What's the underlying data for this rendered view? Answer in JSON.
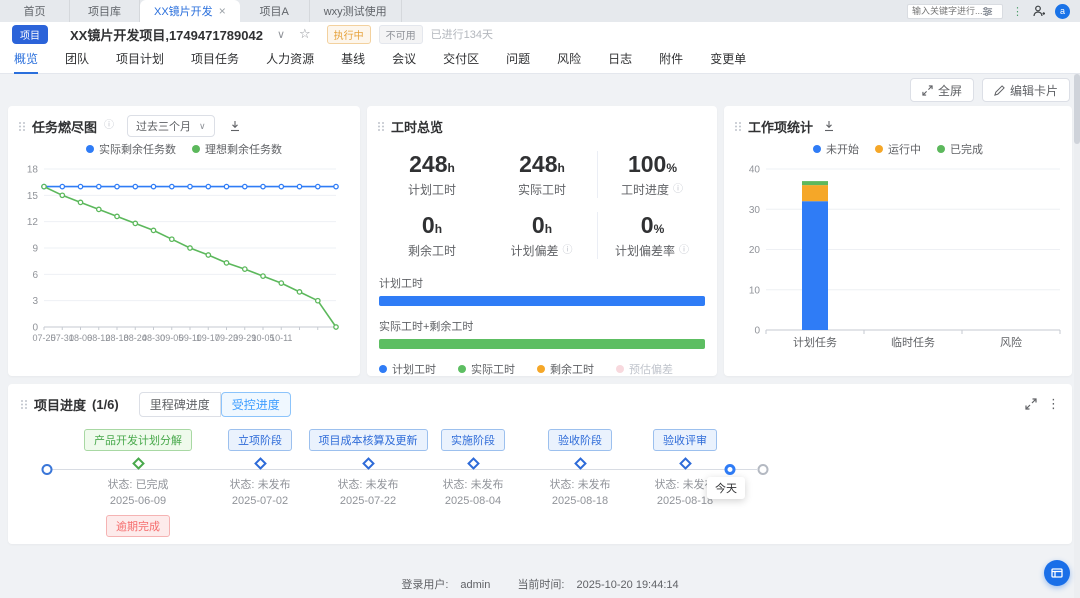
{
  "icons": {
    "info": "ⓘ",
    "chevron_down": "∨",
    "star": "☆",
    "close": "×",
    "more": "⋮"
  },
  "top_bar": {
    "tabs": [
      {
        "label": "首页"
      },
      {
        "label": "项目库"
      },
      {
        "label": "XX镜片开发",
        "active": true
      },
      {
        "label": "项目A"
      },
      {
        "label": "wxy测试使用"
      }
    ],
    "search_placeholder": "输入关键字进行...",
    "avatar_letter": "a"
  },
  "project_header": {
    "badge": "项目",
    "title": "XX镜片开发项目,1749471789042",
    "status_running": "执行中",
    "status_disabled": "不可用",
    "duration": "已进行134天"
  },
  "nav": {
    "tabs": [
      "概览",
      "团队",
      "项目计划",
      "项目任务",
      "人力资源",
      "基线",
      "会议",
      "交付区",
      "问题",
      "风险",
      "日志",
      "附件",
      "变更单"
    ],
    "active": "概览"
  },
  "toolbar": {
    "fullscreen": "全屏",
    "edit_cards": "编辑卡片"
  },
  "burndown_card": {
    "title": "任务燃尽图",
    "range_select": "过去三个月"
  },
  "hours_card": {
    "title": "工时总览",
    "stats": [
      {
        "value": "248",
        "unit": "h",
        "label": "计划工时"
      },
      {
        "value": "248",
        "unit": "h",
        "label": "实际工时"
      },
      {
        "value": "100",
        "unit": "%",
        "label": "工时进度"
      },
      {
        "value": "0",
        "unit": "h",
        "label": "剩余工时"
      },
      {
        "value": "0",
        "unit": "h",
        "label": "计划偏差"
      },
      {
        "value": "0",
        "unit": "%",
        "label": "计划偏差率"
      }
    ],
    "bars": [
      {
        "label": "计划工时",
        "color": "#2f7cf6",
        "percent": 100
      },
      {
        "label": "实际工时+剩余工时",
        "color": "#5dbe62",
        "percent": 100
      }
    ],
    "legend": [
      {
        "label": "计划工时",
        "color": "#2f7cf6"
      },
      {
        "label": "实际工时",
        "color": "#5dbe62"
      },
      {
        "label": "剩余工时",
        "color": "#f5a728"
      },
      {
        "label": "预估偏差",
        "color": "#f8d9de"
      }
    ]
  },
  "workitem_card": {
    "title": "工作项统计"
  },
  "progress_card": {
    "title": "项目进度",
    "count": "(1/6)",
    "toggle": [
      {
        "label": "里程碑进度",
        "active": false
      },
      {
        "label": "受控进度",
        "active": true
      }
    ],
    "status_prefix": "状态:",
    "today_label": "今天",
    "milestones": [
      {
        "name": "产品开发计划分解",
        "status": "已完成",
        "date": "2025-06-09",
        "extra": "逾期完成",
        "state": "done"
      },
      {
        "name": "立项阶段",
        "status": "未发布",
        "date": "2025-07-02",
        "state": "pending"
      },
      {
        "name": "项目成本核算及更新",
        "status": "未发布",
        "date": "2025-07-22",
        "state": "pending"
      },
      {
        "name": "实施阶段",
        "status": "未发布",
        "date": "2025-08-04",
        "state": "pending"
      },
      {
        "name": "验收阶段",
        "status": "未发布",
        "date": "2025-08-18",
        "state": "pending"
      },
      {
        "name": "验收评审",
        "status": "未发布",
        "date": "2025-08-18",
        "state": "pending"
      }
    ]
  },
  "footer": {
    "user_label": "登录用户:",
    "user": "admin",
    "time_label": "当前时间:",
    "time": "2025-10-20 19:44:14"
  },
  "chart_data": [
    {
      "id": "burndown",
      "type": "line",
      "title": "任务燃尽图",
      "x": [
        "07-25",
        "07-31",
        "08-06",
        "08-12",
        "08-18",
        "08-24",
        "08-30",
        "09-05",
        "09-11",
        "09-17",
        "09-23",
        "09-29",
        "10-05",
        "10-11"
      ],
      "series": [
        {
          "name": "实际剩余任务数",
          "color": "#2f7cf6",
          "values": [
            16,
            16,
            16,
            16,
            16,
            16,
            16,
            16,
            16,
            16,
            16,
            16,
            16,
            16,
            16,
            16,
            16
          ]
        },
        {
          "name": "理想剩余任务数",
          "color": "#5cb85c",
          "values": [
            16,
            15,
            14.2,
            13.4,
            12.6,
            11.8,
            11,
            10,
            9,
            8.2,
            7.3,
            6.6,
            5.8,
            5,
            4,
            3,
            0
          ]
        }
      ],
      "ylim": [
        0,
        18
      ],
      "yticks": [
        0,
        3,
        6,
        9,
        12,
        15,
        18
      ],
      "grid": true,
      "legend_position": "top"
    },
    {
      "id": "workitems",
      "type": "bar",
      "stacked": true,
      "title": "工作项统计",
      "categories": [
        "计划任务",
        "临时任务",
        "风险"
      ],
      "series": [
        {
          "name": "未开始",
          "color": "#2f7cf6",
          "values": [
            32,
            0,
            0
          ]
        },
        {
          "name": "运行中",
          "color": "#f5a728",
          "values": [
            4,
            0,
            0
          ]
        },
        {
          "name": "已完成",
          "color": "#5cb85c",
          "values": [
            1,
            0,
            0
          ]
        }
      ],
      "ylim": [
        0,
        40
      ],
      "yticks": [
        0,
        10,
        20,
        30,
        40
      ],
      "grid": true,
      "legend_position": "top"
    }
  ]
}
